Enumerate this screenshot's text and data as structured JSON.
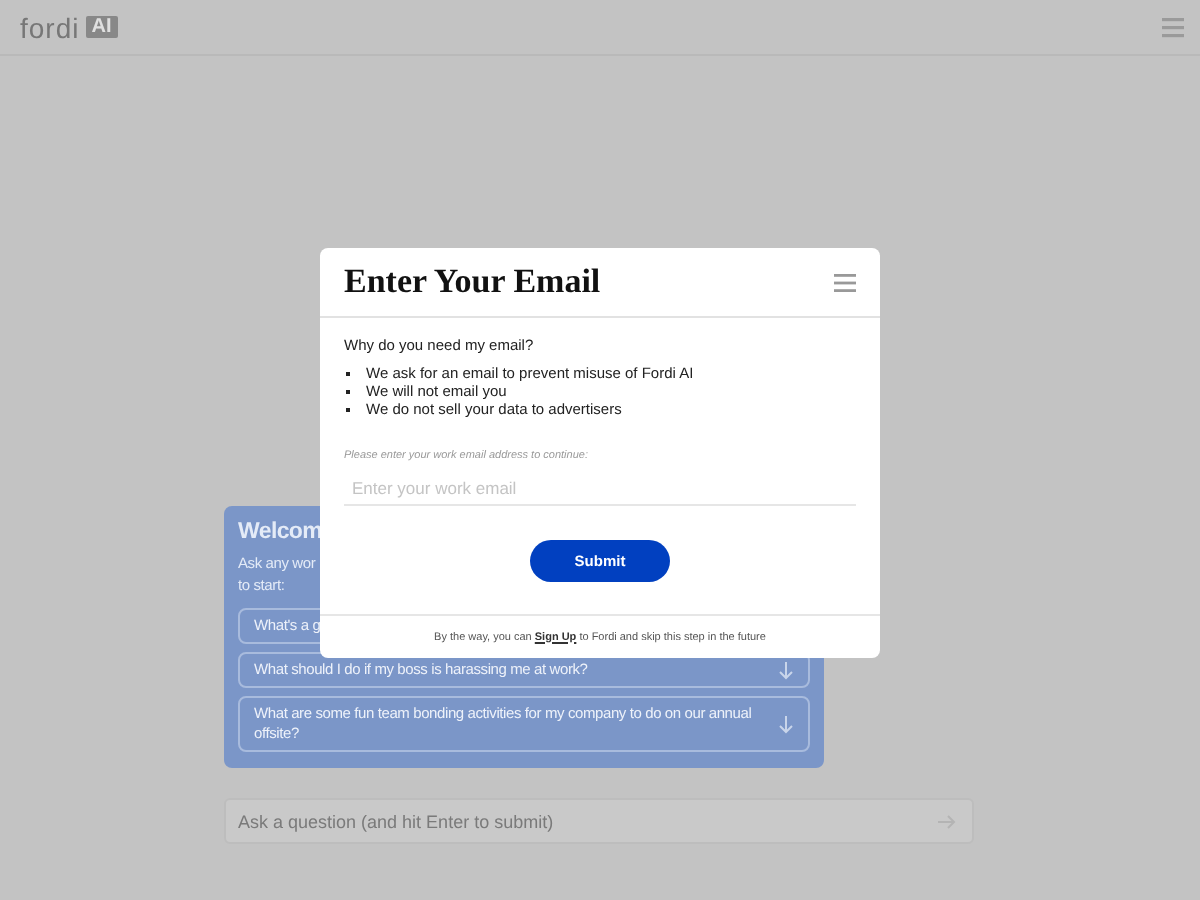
{
  "header": {
    "logo": "fordi",
    "logo_badge": "AI"
  },
  "welcome": {
    "title": "Welcom",
    "description_lines": [
      "Ask any wor",
      "to start:"
    ],
    "suggestions": [
      {
        "text": "What's a g",
        "arrow": false
      },
      {
        "text": "What should I do if my boss is harassing me at work?",
        "arrow": true
      },
      {
        "text": "What are some fun team bonding activities for my company to do on our annual offsite?",
        "arrow": true
      }
    ]
  },
  "question": {
    "placeholder": "Ask a question (and hit Enter to submit)"
  },
  "modal": {
    "title": "Enter Your Email",
    "question": "Why do you need my email?",
    "reasons": [
      "We ask for an email to prevent misuse of Fordi AI",
      "We will not email you",
      "We do not sell your data to advertisers"
    ],
    "hint": "Please enter your work email address to continue:",
    "email": {
      "placeholder": "Enter your work email"
    },
    "submit": "Submit",
    "footer": {
      "before": "By the way, you can ",
      "link": "Sign Up",
      "after": " to Fordi and skip this step in the future"
    }
  }
}
